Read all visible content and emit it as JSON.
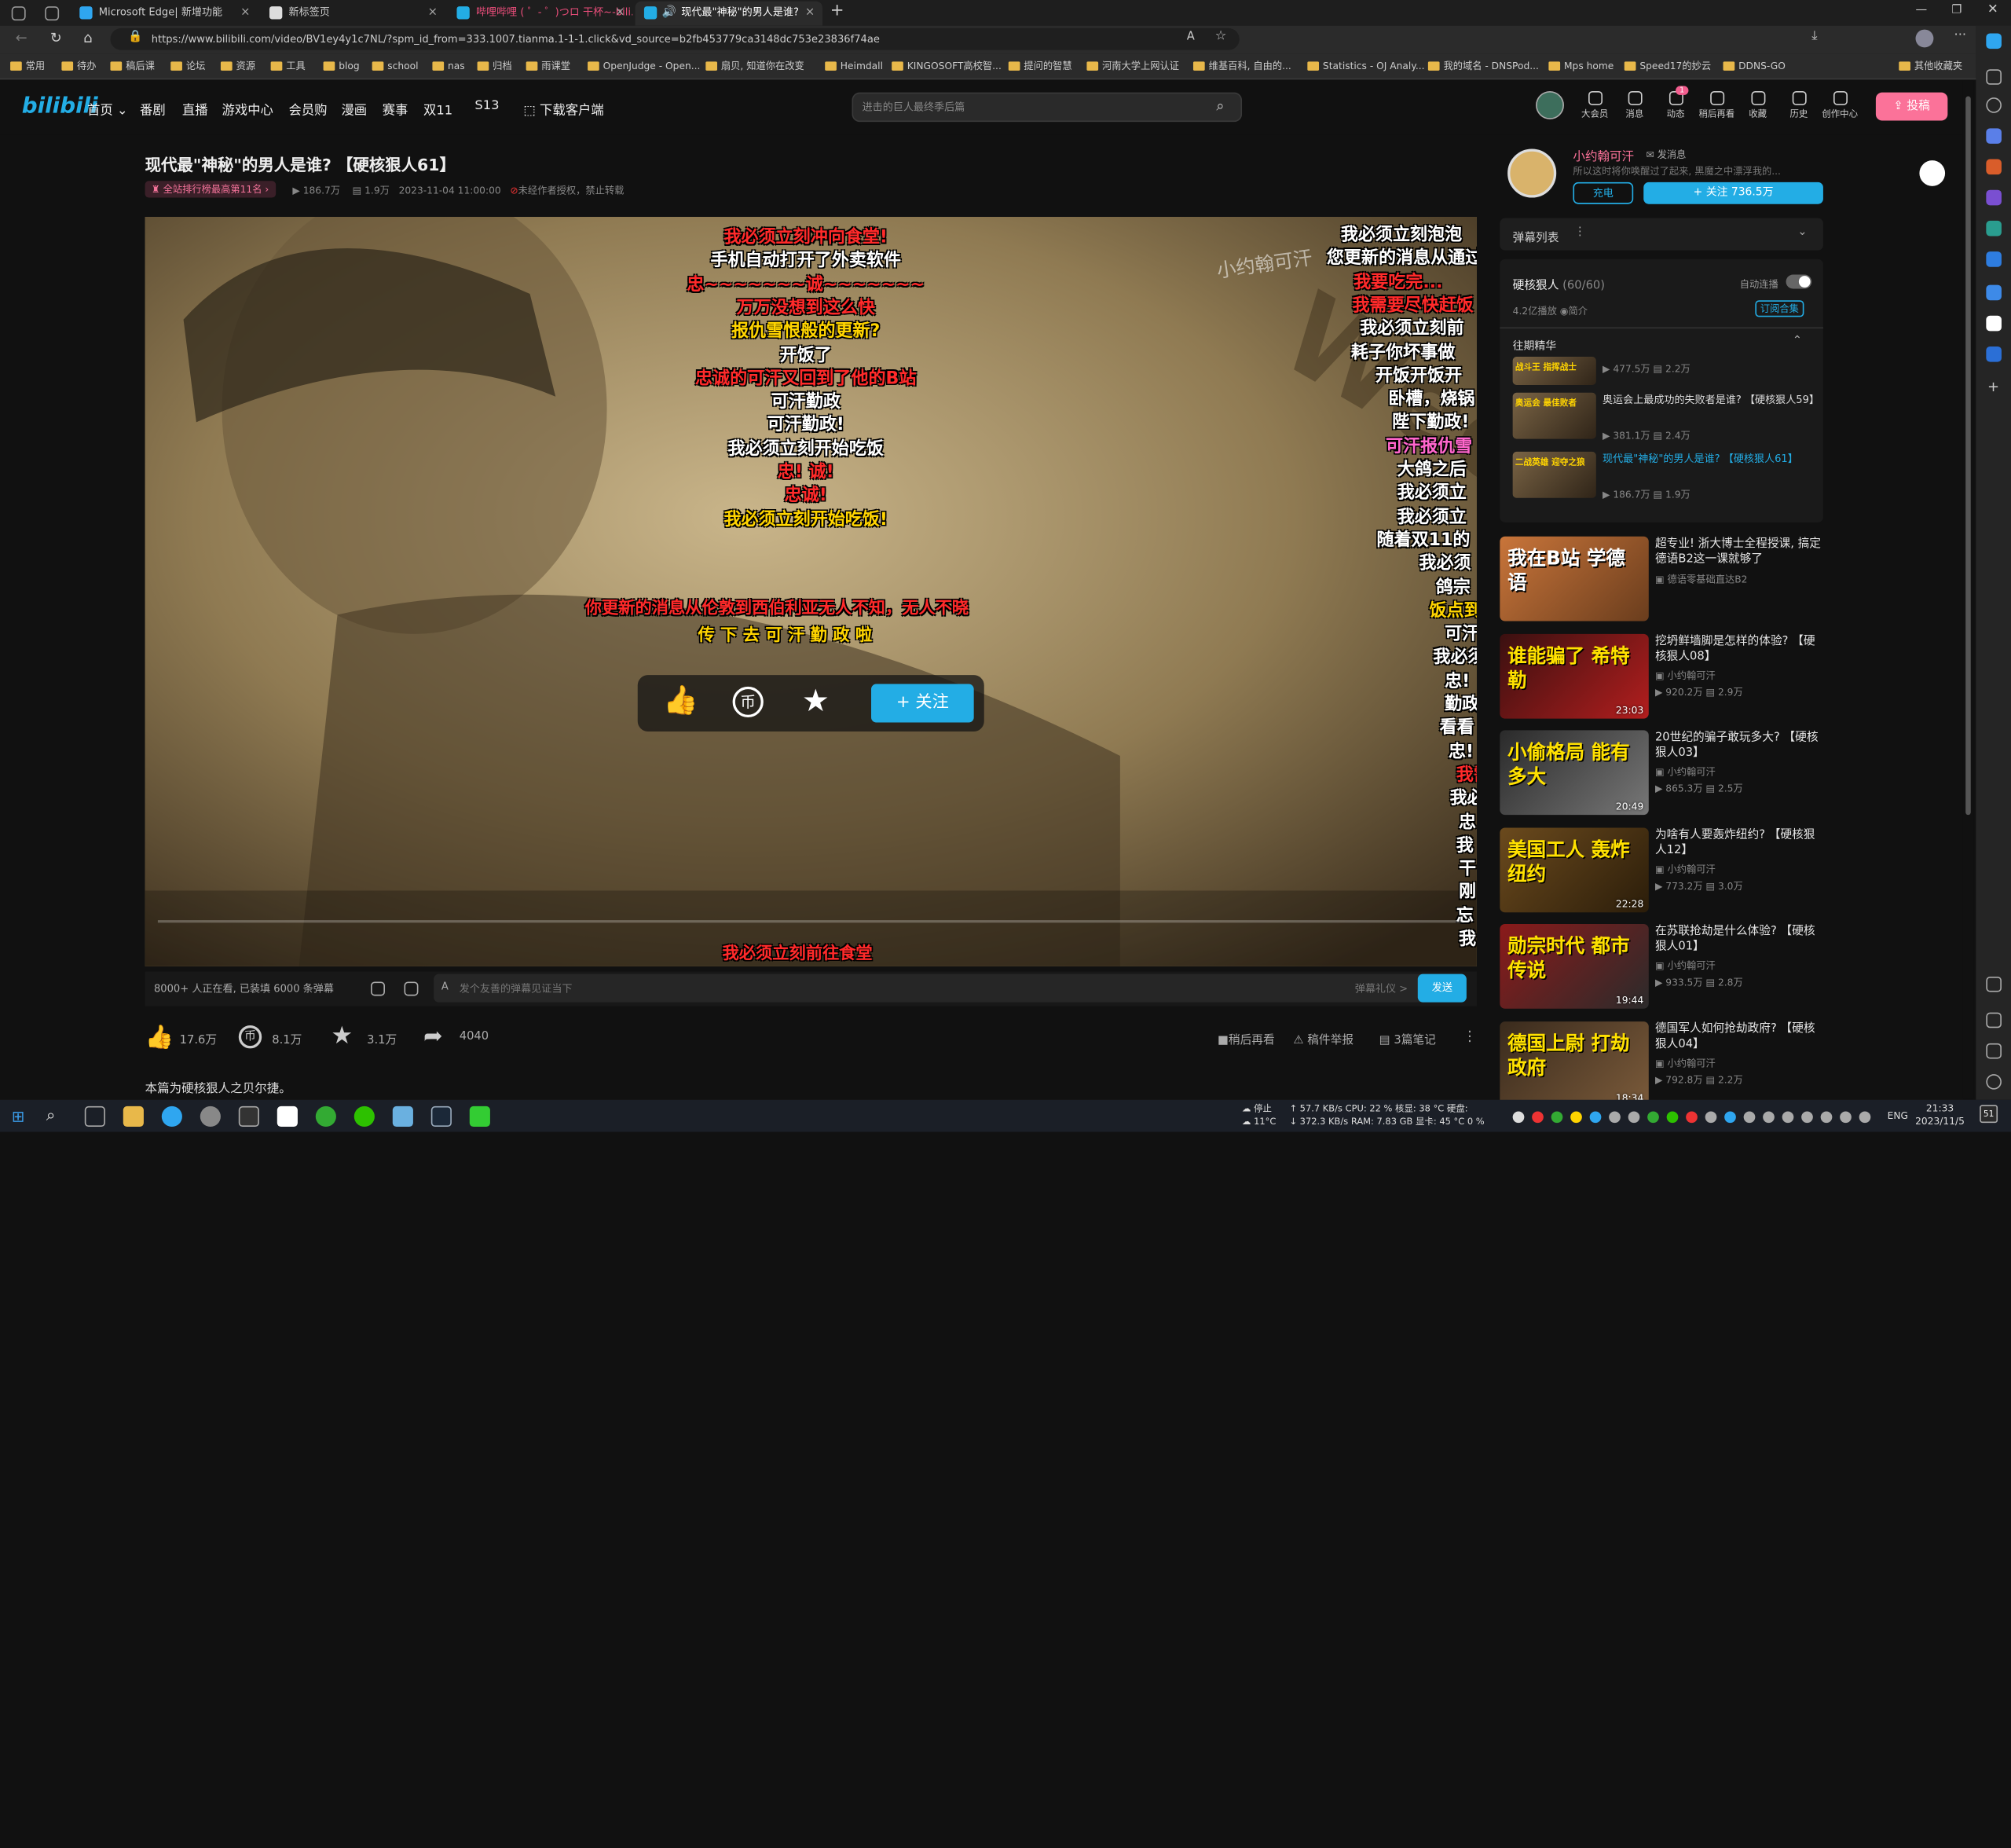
{
  "browser": {
    "tabs": [
      {
        "title": "Microsoft Edge| 新增功能"
      },
      {
        "title": "新标签页"
      },
      {
        "title": "哔哩哔哩 ( ゜- ゜)つロ 干杯~-bili..."
      },
      {
        "title": "现代最\"神秘\"的男人是谁?"
      }
    ],
    "url": "https://www.bilibili.com/video/BV1ey4y1c7NL/?spm_id_from=333.1007.tianma.1-1-1.click&vd_source=b2fb453779ca3148dc753e23836f74ae",
    "bookmarks": [
      "常用",
      "待办",
      "稿后课",
      "论坛",
      "资源",
      "工具",
      "blog",
      "school",
      "nas",
      "归档",
      "雨课堂",
      "OpenJudge - Open...",
      "扇贝, 知道你在改变",
      "Heimdall",
      "KINGOSOFT高校智...",
      "提问的智慧",
      "河南大学上网认证",
      "维基百科, 自由的...",
      "Statistics - OJ Analy...",
      "我的域名 - DNSPod...",
      "Mps home",
      "Speed17的妙云",
      "DDNS-GO",
      "其他收藏夹"
    ]
  },
  "site": {
    "logo": "bilibili",
    "nav": [
      "首页",
      "番剧",
      "直播",
      "游戏中心",
      "会员购",
      "漫画",
      "赛事",
      "双11",
      "S13",
      "下载客户端"
    ],
    "search_placeholder": "进击的巨人最终季后篇",
    "top_icons": [
      "大会员",
      "消息",
      "动态",
      "稍后再看",
      "收藏",
      "历史",
      "创作中心"
    ],
    "dynamic_badge": "1",
    "upload": "投稿"
  },
  "video": {
    "title": "现代最\"神秘\"的男人是谁? 【硬核狠人61】",
    "rank_badge": "全站排行榜最高第11名",
    "plays": "186.7万",
    "danmaku_count": "1.9万",
    "date": "2023-11-04 11:00:00",
    "notice": "未经作者授权，禁止转载",
    "watermark": "小约翰可汗",
    "danmaku_center": [
      {
        "text": "我必须立刻冲向食堂!",
        "color": "#ff2a2a"
      },
      {
        "text": "手机自动打开了外卖软件",
        "color": "#ffffff"
      },
      {
        "text": "忠~~~~~~~诚~~~~~~~",
        "color": "#ff2a2a"
      },
      {
        "text": "万万没想到这么快",
        "color": "#ff2a2a"
      },
      {
        "text": "报仇雪恨般的更新?",
        "color": "#ffd400"
      },
      {
        "text": "开饭了",
        "color": "#ffffff"
      },
      {
        "text": "忠诚的可汗又回到了他的B站",
        "color": "#ff2a2a"
      },
      {
        "text": "可汗勤政",
        "color": "#ffffff"
      },
      {
        "text": "可汗勤政!",
        "color": "#ffffff"
      },
      {
        "text": "我必须立刻开始吃饭",
        "color": "#ffffff"
      },
      {
        "text": "忠! 诚!",
        "color": "#ff2a2a"
      },
      {
        "text": "忠诚!",
        "color": "#ff2a2a"
      },
      {
        "text": "我必须立刻开始吃饭!",
        "color": "#ffd400"
      }
    ],
    "danmaku_mid1": "你更新的消息从伦敦到西伯利亚无人不知，无人不晓",
    "danmaku_mid2": "传 下 去 可 汗 勤 政 啦",
    "danmaku_bottom": "我必须立刻前往食堂",
    "danmaku_right": [
      {
        "text": "我必须立刻泡泡",
        "color": "#ffffff"
      },
      {
        "text": "您更新的消息从通过",
        "color": "#ffffff"
      },
      {
        "text": "我要吃完...",
        "color": "#ff2a2a"
      },
      {
        "text": "我需要尽快赶饭",
        "color": "#ff2a2a"
      },
      {
        "text": "我必须立刻前",
        "color": "#ffffff"
      },
      {
        "text": "耗子你坏事做",
        "color": "#ffffff"
      },
      {
        "text": "开饭开饭开",
        "color": "#ffffff"
      },
      {
        "text": "卧槽，烧锅",
        "color": "#ffffff"
      },
      {
        "text": "陛下勤政!",
        "color": "#ffffff"
      },
      {
        "text": "可汗报仇雪",
        "color": "#ff66cc"
      },
      {
        "text": "大鸽之后",
        "color": "#ffffff"
      },
      {
        "text": "我必须立",
        "color": "#ffffff"
      },
      {
        "text": "我必须立",
        "color": "#ffffff"
      },
      {
        "text": "随着双11的",
        "color": "#ffffff"
      },
      {
        "text": "我必须",
        "color": "#ffffff"
      },
      {
        "text": "鸽宗",
        "color": "#ffffff"
      },
      {
        "text": "饭点到",
        "color": "#ffd400"
      },
      {
        "text": "可汗",
        "color": "#ffffff"
      },
      {
        "text": "我必须",
        "color": "#ffffff"
      },
      {
        "text": "忠!",
        "color": "#ffffff"
      },
      {
        "text": "勤政",
        "color": "#ffffff"
      },
      {
        "text": "看看",
        "color": "#ffffff"
      },
      {
        "text": "忠!",
        "color": "#ffffff"
      },
      {
        "text": "我需",
        "color": "#ff2a2a"
      },
      {
        "text": "我必",
        "color": "#ffffff"
      },
      {
        "text": "忠",
        "color": "#ffffff"
      },
      {
        "text": "我",
        "color": "#ffffff"
      },
      {
        "text": "干",
        "color": "#ffffff"
      },
      {
        "text": "刚",
        "color": "#ffffff"
      },
      {
        "text": "忘",
        "color": "#ffffff"
      },
      {
        "text": "我",
        "color": "#ffffff"
      }
    ],
    "follow_button": "+ 关注",
    "viewers": "8000+ 人正在看, 已装填 6000 条弹幕",
    "danmaku_placeholder": "发个友善的弹幕见证当下",
    "danmaku_etiquette": "弹幕礼仪 >",
    "send": "发送",
    "likes": "17.6万",
    "coins": "8.1万",
    "favorites": "3.1万",
    "shares": "4040",
    "watch_later": "稍后再看",
    "report": "稿件举报",
    "notes": "3篇笔记",
    "description": "本篇为硬核狠人之贝尔捷。"
  },
  "uploader": {
    "name": "小约翰可汗",
    "message": "发消息",
    "desc": "所以这时将你唤醒过了起来, 黑魔之中漂浮我的...",
    "charge": "充电",
    "follow": "+ 关注 736.5万"
  },
  "danmaku_list": {
    "label": "弹幕列表"
  },
  "collection": {
    "name": "硬核狠人",
    "progress": "(60/60)",
    "autoplay": "自动连播",
    "stats": "4.2亿播放",
    "intro": "简介",
    "subscribe": "订阅合集",
    "section": "往期精华",
    "items": [
      {
        "title": "",
        "plays": "477.5万",
        "danmaku": "2.2万",
        "cover": "战斗王 指挥战士"
      },
      {
        "title": "奥运会上最成功的失败者是谁? 【硬核狠人59】",
        "plays": "381.1万",
        "danmaku": "2.4万",
        "cover": "奥运会 最佳败者"
      },
      {
        "title": "现代最\"神秘\"的男人是谁? 【硬核狠人61】",
        "plays": "186.7万",
        "danmaku": "1.9万",
        "cover": "二战英雄 迎夺之狼"
      }
    ]
  },
  "recommendations": [
    {
      "title": "超专业! 浙大博士全程授课, 搞定德语B2这一课就够了",
      "author": "德语零基础直达B2",
      "plays": "",
      "danmaku": "",
      "duration": "",
      "cover": "我在B站 学德语"
    },
    {
      "title": "挖坍鲜墙脚是怎样的体验? 【硬核狠人08】",
      "author": "小约翰可汗",
      "plays": "920.2万",
      "danmaku": "2.9万",
      "duration": "23:03",
      "cover": "谁能骗了 希特勒"
    },
    {
      "title": "20世纪的骗子敢玩多大? 【硬核狠人03】",
      "author": "小约翰可汗",
      "plays": "865.3万",
      "danmaku": "2.5万",
      "duration": "20:49",
      "cover": "小偷格局 能有多大"
    },
    {
      "title": "为啥有人要轰炸纽约? 【硬核狠人12】",
      "author": "小约翰可汗",
      "plays": "773.2万",
      "danmaku": "3.0万",
      "duration": "22:28",
      "cover": "美国工人 轰炸纽约"
    },
    {
      "title": "在苏联抢劫是什么体验? 【硬核狠人01】",
      "author": "小约翰可汗",
      "plays": "933.5万",
      "danmaku": "2.8万",
      "duration": "19:44",
      "cover": "勋宗时代 都市传说"
    },
    {
      "title": "德国军人如何抢劫政府? 【硬核狠人04】",
      "author": "小约翰可汗",
      "plays": "792.8万",
      "danmaku": "2.2万",
      "duration": "18:34",
      "cover": "德国上尉 打劫政府"
    }
  ],
  "taskbar": {
    "weather_status": "停止",
    "temperature": "11°C",
    "net_up": "57.7 KB/s",
    "net_down": "372.3 KB/s",
    "cpu": "CPU: 22 %",
    "ram": "RAM: 7.83 GB",
    "cpu_temp": "核显: 38 °C",
    "gpu_temp": "显卡: 45 °C",
    "disk": "硬盘:",
    "disk_val": "0 %",
    "lang": "ENG",
    "time": "21:33",
    "date": "2023/11/5",
    "notif_count": "51"
  }
}
